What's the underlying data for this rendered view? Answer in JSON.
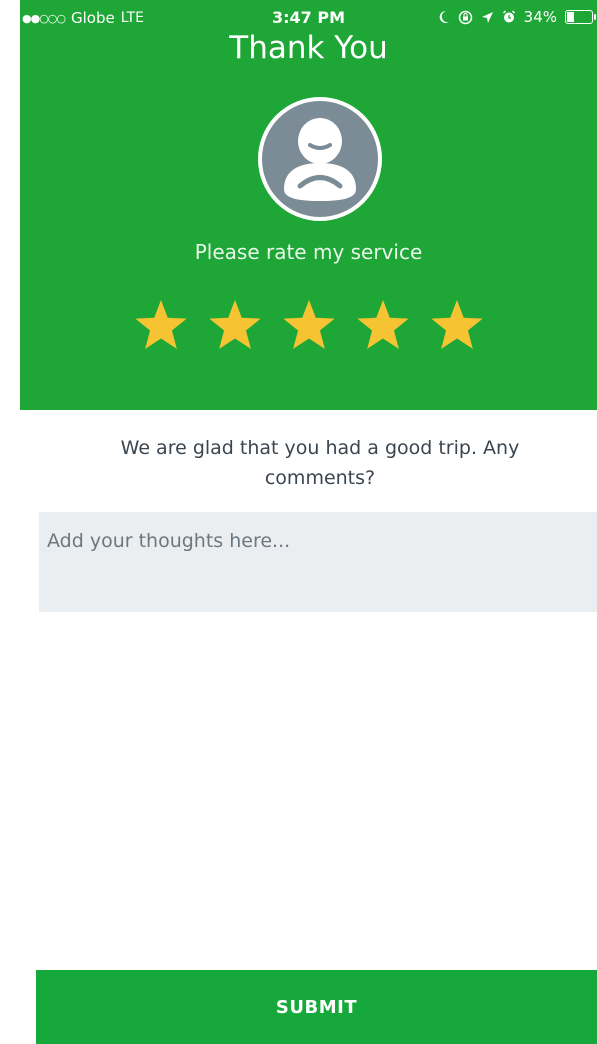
{
  "status_bar": {
    "carrier": "Globe",
    "network": "LTE",
    "time": "3:47 PM",
    "battery": "34%",
    "battery_level": 0.34,
    "signal_bars": 2,
    "icons": [
      "moon-icon",
      "orientation-lock-icon",
      "location-icon",
      "alarm-icon",
      "battery-icon"
    ]
  },
  "header": {
    "title": "Thank You",
    "avatar_icon": "user-avatar-icon",
    "rating_prompt": "Please rate my service"
  },
  "rating": {
    "max": 5,
    "value": 5,
    "star_color": "#f6c432"
  },
  "comments": {
    "prompt": "We are glad that you had a good trip. Any comments?",
    "placeholder": "Add your thoughts here..."
  },
  "actions": {
    "submit_label": "SUBMIT"
  },
  "colors": {
    "brand_green": "#1ea637",
    "button_green": "#16a83a",
    "star_yellow": "#f6c432",
    "avatar_gray": "#7b8c96"
  }
}
